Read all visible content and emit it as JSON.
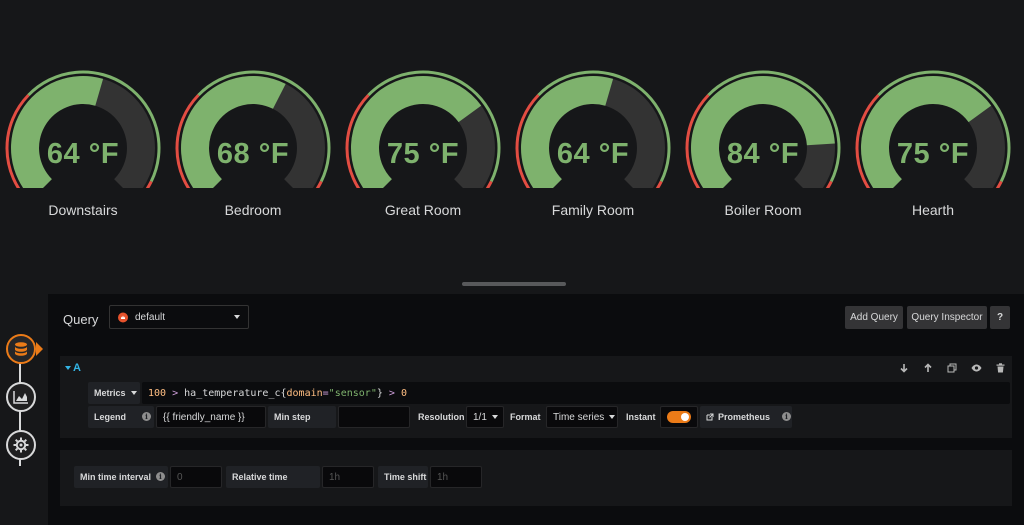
{
  "gauges": [
    {
      "value": "64 °F",
      "name": "Downstairs",
      "fill": 0.56
    },
    {
      "value": "68 °F",
      "name": "Bedroom",
      "fill": 0.6
    },
    {
      "value": "75 °F",
      "name": "Great Room",
      "fill": 0.7
    },
    {
      "value": "64 °F",
      "name": "Family Room",
      "fill": 0.56
    },
    {
      "value": "84 °F",
      "name": "Boiler Room",
      "fill": 0.82
    },
    {
      "value": "75 °F",
      "name": "Hearth",
      "fill": 0.7
    }
  ],
  "colors": {
    "green": "#7eb26d",
    "red": "#e24d42",
    "track": "#333333",
    "accent": "#eb7b18",
    "query_letter": "#33b5e5"
  },
  "editor": {
    "query_label": "Query",
    "datasource": "default",
    "add_query": "Add Query",
    "query_inspector": "Query Inspector",
    "help": "?",
    "row_letter": "A",
    "metrics_label": "Metrics",
    "expr_num": "100",
    "expr_gt1": ">",
    "expr_metric": "ha_temperature_c",
    "expr_brace_open": "{",
    "expr_label_key": "domain",
    "expr_eq": "=",
    "expr_label_val": "\"sensor\"",
    "expr_brace_close": "}",
    "expr_gt2": ">",
    "expr_zero": "0",
    "legend_label": "Legend",
    "legend_value": "{{ friendly_name }}",
    "min_step_label": "Min step",
    "resolution_label": "Resolution",
    "resolution_value": "1/1",
    "format_label": "Format",
    "format_value": "Time series",
    "instant_label": "Instant",
    "prometheus_link": "Prometheus",
    "min_interval_label": "Min time interval",
    "min_interval_placeholder": "0",
    "relative_time_label": "Relative time",
    "relative_time_placeholder": "1h",
    "time_shift_label": "Time shift",
    "time_shift_placeholder": "1h",
    "info_glyph": "i"
  },
  "icons": [
    "database-icon",
    "chart-area-icon",
    "gear-icon",
    "arrow-down-icon",
    "arrow-up-icon",
    "copy-icon",
    "eye-icon",
    "trash-icon"
  ]
}
